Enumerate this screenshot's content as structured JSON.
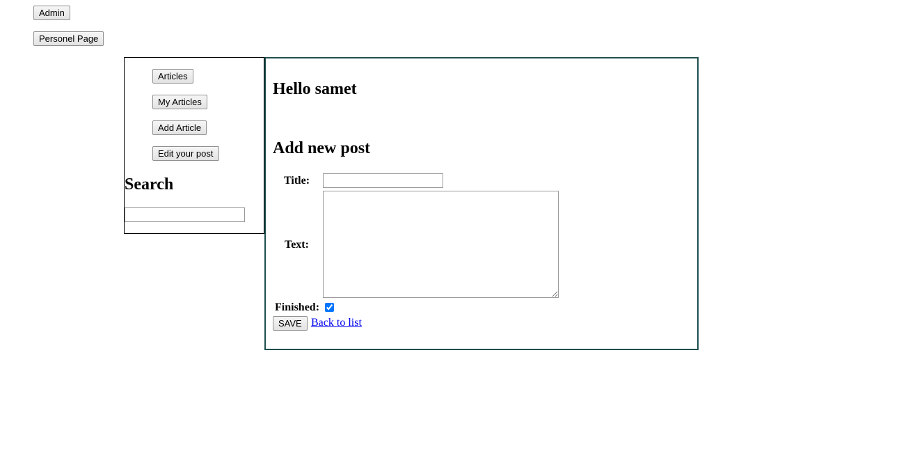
{
  "topnav": {
    "admin_label": "Admin",
    "personel_label": "Personel Page"
  },
  "sidebar": {
    "items": [
      {
        "label": "Articles"
      },
      {
        "label": "My Articles"
      },
      {
        "label": "Add Article"
      },
      {
        "label": "Edit your post"
      }
    ],
    "search_heading": "Search",
    "search_value": ""
  },
  "main": {
    "greeting": "Hello samet",
    "form_heading": "Add new post",
    "title_label": "Title:",
    "title_value": "",
    "text_label": "Text:",
    "text_value": "",
    "finished_label": "Finished:",
    "finished_checked": true,
    "save_label": "SAVE",
    "back_link_label": "Back to list"
  }
}
